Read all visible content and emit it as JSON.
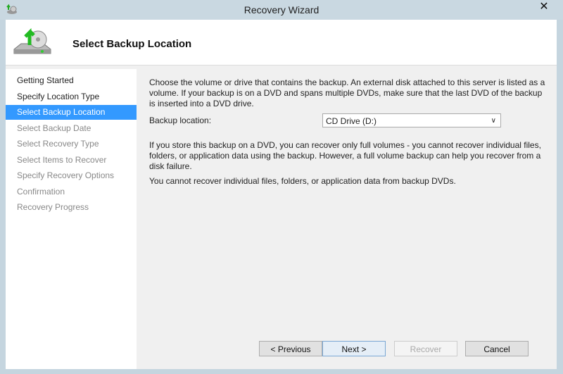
{
  "window": {
    "title": "Recovery Wizard",
    "close": "✕"
  },
  "header": {
    "title": "Select Backup Location"
  },
  "steps": [
    {
      "label": "Getting Started",
      "state": "done"
    },
    {
      "label": "Specify Location Type",
      "state": "done"
    },
    {
      "label": "Select Backup Location",
      "state": "active"
    },
    {
      "label": "Select Backup Date",
      "state": "pending"
    },
    {
      "label": "Select Recovery Type",
      "state": "pending"
    },
    {
      "label": "Select Items to Recover",
      "state": "pending"
    },
    {
      "label": "Specify Recovery Options",
      "state": "pending"
    },
    {
      "label": "Confirmation",
      "state": "pending"
    },
    {
      "label": "Recovery Progress",
      "state": "pending"
    }
  ],
  "main": {
    "intro": "Choose the volume or drive that contains the backup. An external disk attached to this server is listed as a volume. If your backup is on a DVD and spans multiple DVDs, make sure that the last DVD of the backup is inserted into a DVD drive.",
    "location_label": "Backup location:",
    "location_value": "CD Drive (D:)",
    "dvd_note": "If you store this backup on a DVD, you can recover only full volumes - you cannot recover individual files, folders, or application data using the backup. However, a full volume backup can help you recover from a disk failure.",
    "dvd_warning": "You cannot recover individual files, folders, or application data from backup DVDs."
  },
  "buttons": {
    "previous": "< Previous",
    "next": "Next >",
    "recover": "Recover",
    "cancel": "Cancel"
  }
}
